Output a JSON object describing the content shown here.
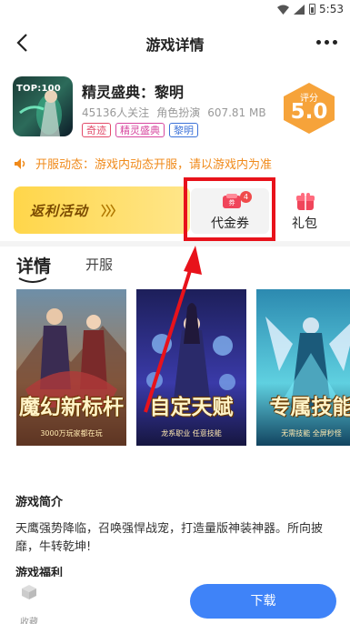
{
  "status_bar": {
    "time": "5:53"
  },
  "nav": {
    "title": "游戏详情"
  },
  "game": {
    "icon_tag": "TOP:100",
    "name": "精灵盛典：黎明",
    "followers": "45136人关注",
    "genre": "角色扮演",
    "size": "607.81 MB",
    "tags": [
      "奇迹",
      "精灵盛典",
      "黎明"
    ]
  },
  "score": {
    "label": "评分",
    "value": "5.0"
  },
  "notice": "开服动态：游戏内动态开服，请以游戏内为准",
  "activity": {
    "rebate_label": "返利活动",
    "coupon_label": "代金券",
    "coupon_badge": "4",
    "gift_label": "礼包"
  },
  "tabs": {
    "detail": "详情",
    "open": "开服"
  },
  "screenshots": [
    {
      "caption": "魔幻新标杆",
      "sub": "3000万玩家都在玩"
    },
    {
      "caption": "自定天赋",
      "sub": "龙系职业 任意技能"
    },
    {
      "caption": "专属技能",
      "sub": "无需技能 全屏秒怪"
    }
  ],
  "intro": {
    "title": "游戏简介",
    "text": "天鹰强势降临，召唤强悍战宠，打造量版神装神器。所向披靡，牛转乾坤!"
  },
  "benefits": {
    "title": "游戏福利"
  },
  "bottom": {
    "fav_label": "收藏",
    "download_label": "下载"
  },
  "colors": {
    "accent": "#3f83f8",
    "notice": "#f08a1a",
    "highlight": "#e8121b",
    "score": "#f6a33a"
  }
}
